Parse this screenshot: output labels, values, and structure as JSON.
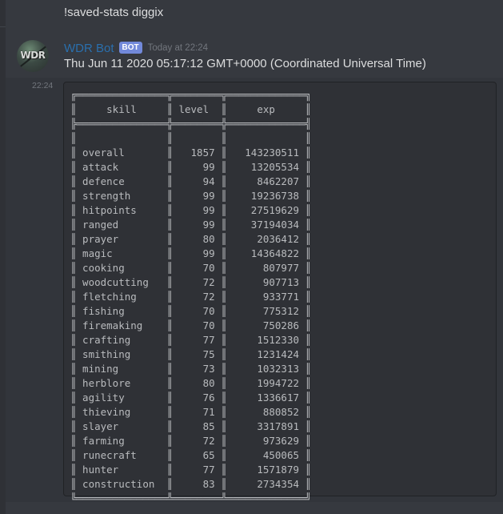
{
  "command_message": {
    "text": "!saved-stats diggix"
  },
  "bot_message": {
    "avatar_text": "WDR",
    "username": "WDR Bot",
    "badge": "BOT",
    "timestamp": "Today at 22:24",
    "side_timestamp": "22:24",
    "content": "Thu Jun 11 2020 05:17:12 GMT+0000 (Coordinated Universal Time)"
  },
  "colors": {
    "username": "#2a6fad",
    "bot_badge": "#7289da",
    "background": "#36393f",
    "codeblock": "#2f3136"
  },
  "table": {
    "columns": [
      "skill",
      "level",
      "exp"
    ],
    "rows": [
      {
        "skill": "overall",
        "level": "1857",
        "exp": "143230511"
      },
      {
        "skill": "attack",
        "level": "99",
        "exp": "13205534"
      },
      {
        "skill": "defence",
        "level": "94",
        "exp": "8462207"
      },
      {
        "skill": "strength",
        "level": "99",
        "exp": "19236738"
      },
      {
        "skill": "hitpoints",
        "level": "99",
        "exp": "27519629"
      },
      {
        "skill": "ranged",
        "level": "99",
        "exp": "37194034"
      },
      {
        "skill": "prayer",
        "level": "80",
        "exp": "2036412"
      },
      {
        "skill": "magic",
        "level": "99",
        "exp": "14364822"
      },
      {
        "skill": "cooking",
        "level": "70",
        "exp": "807977"
      },
      {
        "skill": "woodcutting",
        "level": "72",
        "exp": "907713"
      },
      {
        "skill": "fletching",
        "level": "72",
        "exp": "933771"
      },
      {
        "skill": "fishing",
        "level": "70",
        "exp": "775312"
      },
      {
        "skill": "firemaking",
        "level": "70",
        "exp": "750286"
      },
      {
        "skill": "crafting",
        "level": "77",
        "exp": "1512330"
      },
      {
        "skill": "smithing",
        "level": "75",
        "exp": "1231424"
      },
      {
        "skill": "mining",
        "level": "73",
        "exp": "1032313"
      },
      {
        "skill": "herblore",
        "level": "80",
        "exp": "1994722"
      },
      {
        "skill": "agility",
        "level": "76",
        "exp": "1336617"
      },
      {
        "skill": "thieving",
        "level": "71",
        "exp": "880852"
      },
      {
        "skill": "slayer",
        "level": "85",
        "exp": "3317891"
      },
      {
        "skill": "farming",
        "level": "72",
        "exp": "973629"
      },
      {
        "skill": "runecraft",
        "level": "65",
        "exp": "450065"
      },
      {
        "skill": "hunter",
        "level": "77",
        "exp": "1571879"
      },
      {
        "skill": "construction",
        "level": "83",
        "exp": "2734354"
      }
    ]
  }
}
